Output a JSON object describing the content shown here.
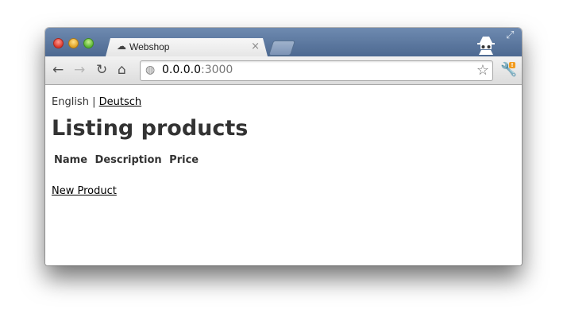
{
  "browser": {
    "tab_title": "Webshop",
    "tab_close": "×",
    "url_host": "0.0.0.0",
    "url_port": ":3000",
    "icons": {
      "back": "arrow-left-icon",
      "forward": "arrow-right-icon",
      "reload": "reload-icon",
      "home": "home-icon",
      "site": "globe-icon",
      "bookmark": "star-icon",
      "menu": "wrench-icon",
      "incognito": "incognito-icon"
    },
    "glyphs": {
      "back": "←",
      "forward": "→",
      "reload": "↻",
      "home": "⌂",
      "globe": "◍",
      "star": "☆",
      "wrench": "🔧",
      "fullscreen": "⤢",
      "tab_icon": "☁"
    },
    "menu_badge": "!"
  },
  "page": {
    "locale_current": "English",
    "locale_separator": "|",
    "locale_other": "Deutsch",
    "heading": "Listing products",
    "columns": [
      "Name",
      "Description",
      "Price"
    ],
    "new_product_link": "New Product"
  },
  "colors": {
    "titlebar": "#5b779d",
    "text": "#333333"
  }
}
